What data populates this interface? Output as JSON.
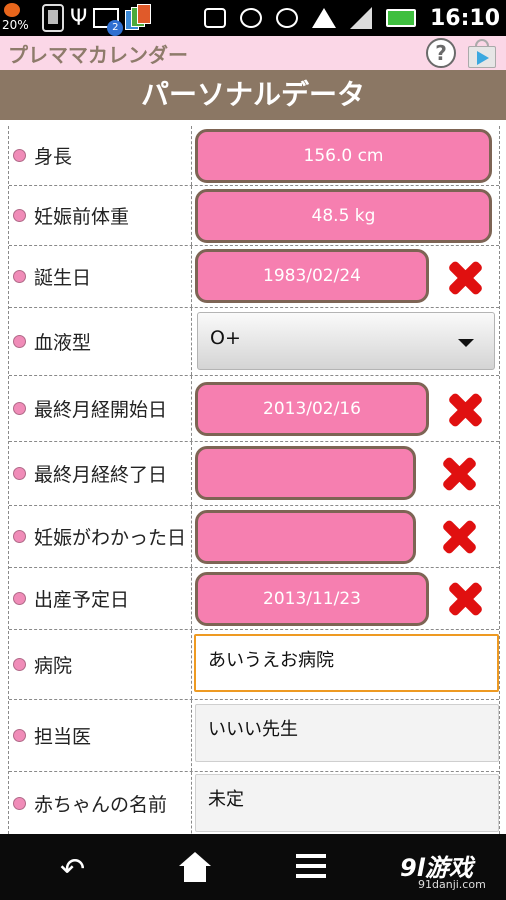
{
  "status_bar": {
    "battery_percent": "20%",
    "notification_count": "2",
    "time": "16:10"
  },
  "app_bar": {
    "title": "プレママカレンダー",
    "help_label": "?"
  },
  "header": {
    "title": "パーソナルデータ"
  },
  "form": {
    "rows": [
      {
        "label": "身長",
        "value": "156.0 cm"
      },
      {
        "label": "妊娠前体重",
        "value": "48.5 kg"
      },
      {
        "label": "誕生日",
        "value": "1983/02/24"
      },
      {
        "label": "血液型",
        "value": "O+"
      },
      {
        "label": "最終月経開始日",
        "value": "2013/02/16"
      },
      {
        "label": "最終月経終了日",
        "value": ""
      },
      {
        "label": "妊娠がわかった日",
        "value": ""
      },
      {
        "label": "出産予定日",
        "value": "2013/11/23"
      },
      {
        "label": "病院",
        "value": "あいうえお病院"
      },
      {
        "label": "担当医",
        "value": "いいい先生"
      },
      {
        "label": "赤ちゃんの名前",
        "value": "未定"
      }
    ]
  },
  "nav_bar": {
    "logo": "9l游戏",
    "url": "91danji.com"
  },
  "colors": {
    "accent_pink": "#f67fb0",
    "header_brown": "#8b7764",
    "appbar_pink": "#fbd7e7",
    "clear_red": "#e01010",
    "focus_orange": "#ee9a22"
  }
}
